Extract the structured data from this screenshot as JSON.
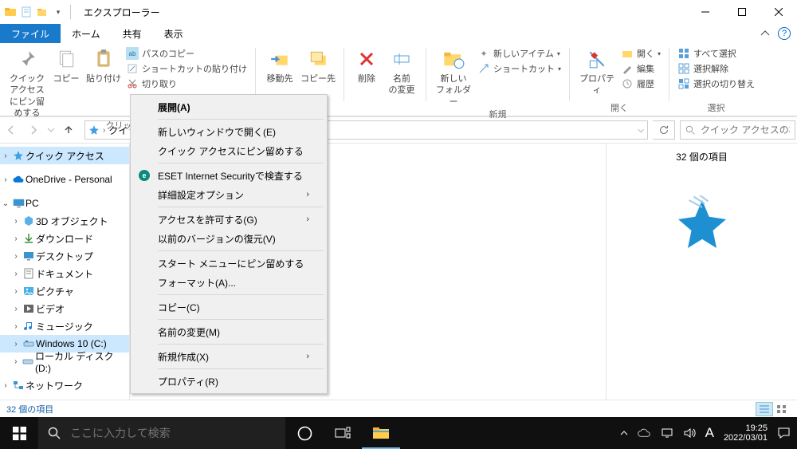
{
  "window": {
    "title": "エクスプローラー"
  },
  "tabs": {
    "file": "ファイル",
    "home": "ホーム",
    "share": "共有",
    "view": "表示"
  },
  "ribbon": {
    "pin_quick": "クイック アクセス\nにピン留めする",
    "copy": "コピー",
    "paste": "貼り付け",
    "path_copy": "パスのコピー",
    "paste_shortcut": "ショートカットの貼り付け",
    "cut": "切り取り",
    "group_clipboard": "クリップ…",
    "move_to": "移動先",
    "copy_to": "コピー先",
    "delete": "削除",
    "rename": "名前\nの変更",
    "group_organize": "",
    "new_folder": "新しい\nフォルダー",
    "new_item": "新しいアイテム",
    "shortcut": "ショートカット",
    "group_new": "新規",
    "properties": "プロパティ",
    "open": "開く",
    "edit": "編集",
    "history": "履歴",
    "group_open": "開く",
    "select_all": "すべて選択",
    "select_none": "選択解除",
    "select_invert": "選択の切り替え",
    "group_select": "選択"
  },
  "nav": {
    "breadcrumb_quick": "クイック …",
    "search_placeholder": "クイック アクセスの検…"
  },
  "tree": {
    "quick_access": "クイック アクセス",
    "onedrive": "OneDrive - Personal",
    "pc": "PC",
    "objects3d": "3D オブジェクト",
    "downloads": "ダウンロード",
    "desktop": "デスクトップ",
    "documents": "ドキュメント",
    "pictures": "ピクチャ",
    "videos": "ビデオ",
    "music": "ミュージック",
    "windows10": "Windows 10 (C:)",
    "localdisk": "ローカル ディスク (D:)",
    "network": "ネットワーク"
  },
  "ctx": {
    "expand": "展開(A)",
    "new_window": "新しいウィンドウで開く(E)",
    "pin_quick": "クイック アクセスにピン留めする",
    "eset": "ESET Internet Securityで検査する",
    "advanced": "詳細設定オプション",
    "give_access": "アクセスを許可する(G)",
    "restore_prev": "以前のバージョンの復元(V)",
    "pin_start": "スタート メニューにピン留めする",
    "format": "フォーマット(A)...",
    "copy": "コピー(C)",
    "rename": "名前の変更(M)",
    "new": "新規作成(X)",
    "properties": "プロパティ(R)"
  },
  "preview": {
    "count_text": "32 個の項目"
  },
  "status": {
    "text": "32 個の項目"
  },
  "taskbar": {
    "search_placeholder": "ここに入力して検索",
    "time": "19:25",
    "date": "2022/03/01",
    "ime": "A"
  }
}
